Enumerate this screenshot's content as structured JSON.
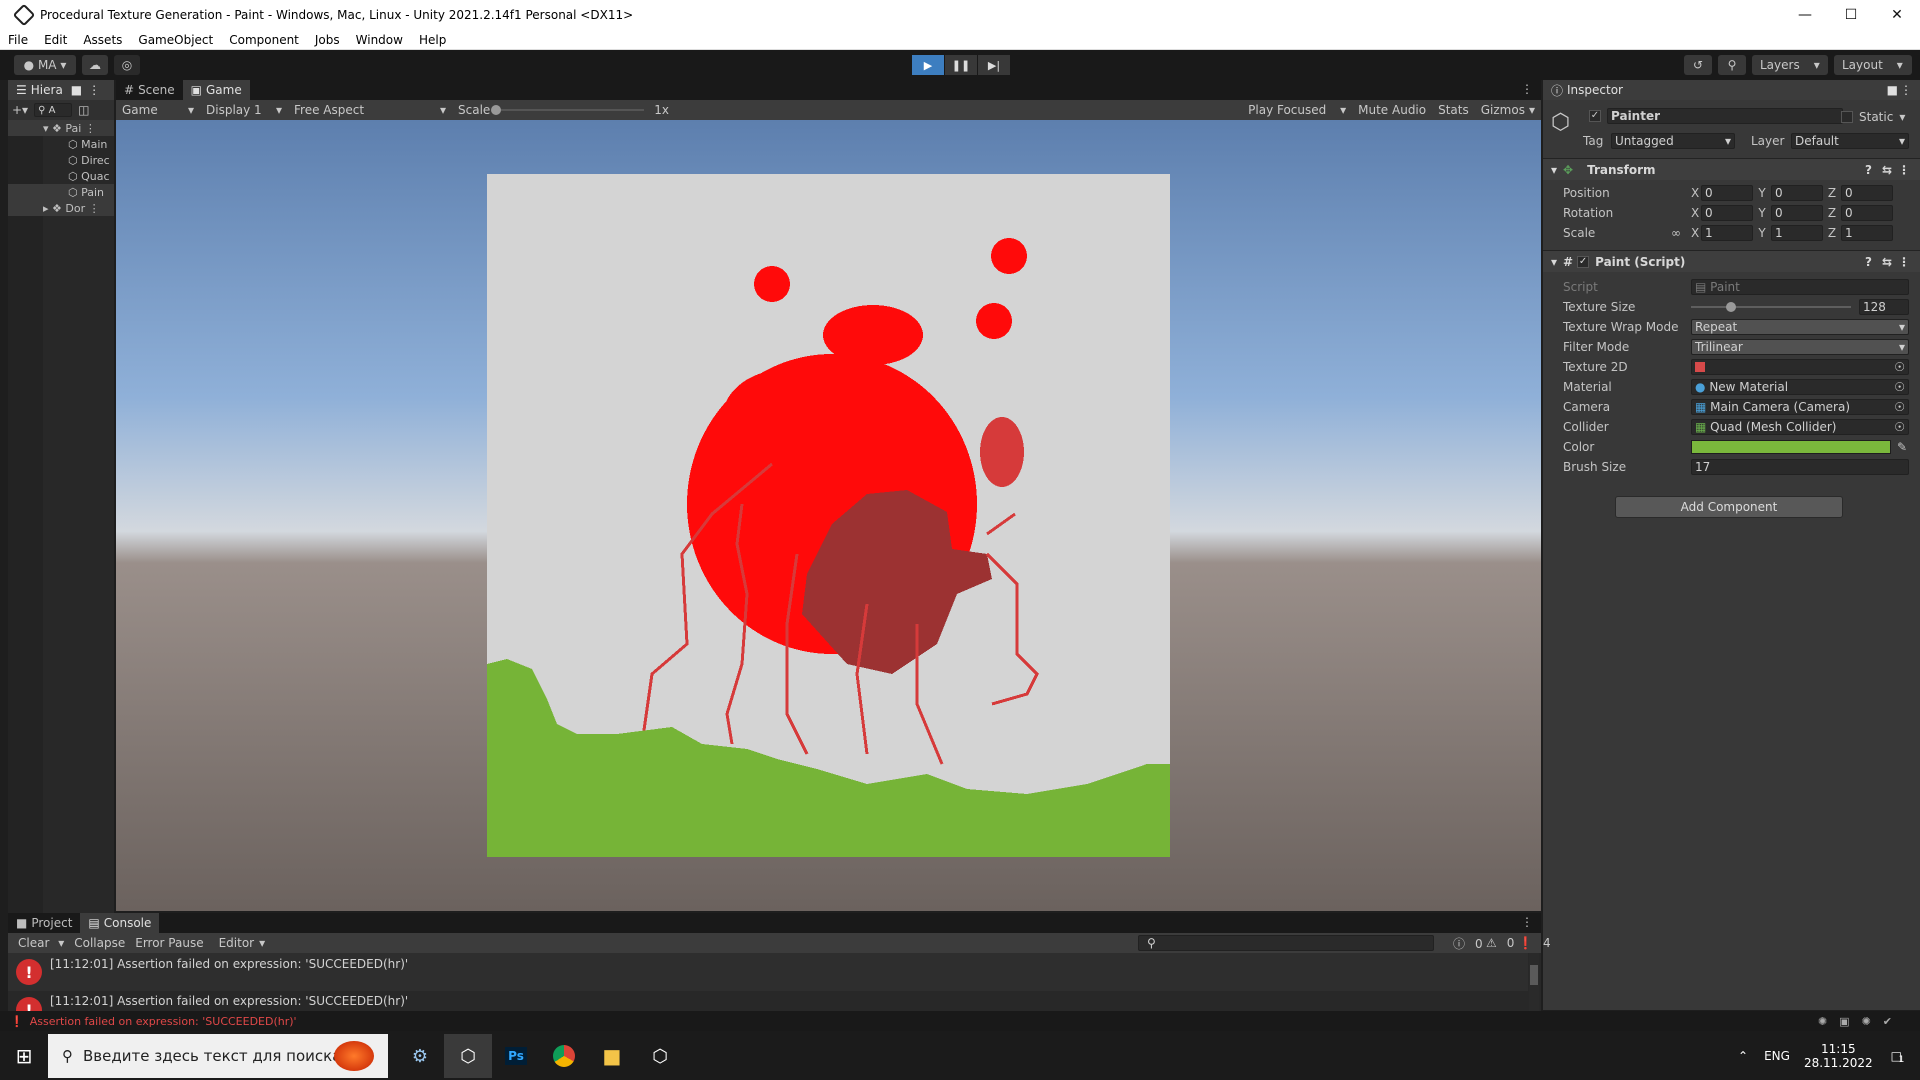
{
  "window": {
    "title": "Procedural Texture Generation - Paint - Windows, Mac, Linux - Unity 2021.2.14f1 Personal <DX11>"
  },
  "menu": [
    "File",
    "Edit",
    "Assets",
    "GameObject",
    "Component",
    "Jobs",
    "Window",
    "Help"
  ],
  "toolbar": {
    "account": "MA",
    "layers": "Layers",
    "layout": "Layout"
  },
  "hierarchy": {
    "tab": "Hiera",
    "search": "A",
    "rows": [
      "Pai",
      "Main",
      "Direc",
      "Quac",
      "Pain",
      "Dor"
    ]
  },
  "tabs": {
    "scene": "Scene",
    "game": "Game",
    "inspector": "Inspector",
    "project": "Project",
    "console": "Console"
  },
  "game_toolbar": {
    "mode": "Game",
    "display": "Display 1",
    "aspect": "Free Aspect",
    "scale_label": "Scale",
    "scale_value": "1x",
    "play_focused": "Play Focused",
    "mute": "Mute Audio",
    "stats": "Stats",
    "gizmos": "Gizmos"
  },
  "inspector": {
    "object_name": "Painter",
    "static_label": "Static",
    "tag_label": "Tag",
    "tag_value": "Untagged",
    "layer_label": "Layer",
    "layer_value": "Default",
    "transform": {
      "title": "Transform",
      "position": "Position",
      "rotation": "Rotation",
      "scale": "Scale",
      "x": "X",
      "y": "Y",
      "z": "Z",
      "pos": [
        "0",
        "0",
        "0"
      ],
      "rot": [
        "0",
        "0",
        "0"
      ],
      "scl": [
        "1",
        "1",
        "1"
      ]
    },
    "paint": {
      "title": "Paint (Script)",
      "script_label": "Script",
      "script_value": "Paint",
      "texture_size_label": "Texture Size",
      "texture_size_value": "128",
      "texture_size_fraction": 0.25,
      "wrap_label": "Texture Wrap Mode",
      "wrap_value": "Repeat",
      "filter_label": "Filter Mode",
      "filter_value": "Trilinear",
      "tex2d_label": "Texture 2D",
      "material_label": "Material",
      "material_value": "New Material",
      "camera_label": "Camera",
      "camera_value": "Main Camera (Camera)",
      "collider_label": "Collider",
      "collider_value": "Quad (Mesh Collider)",
      "color_label": "Color",
      "color_value": "#7ab83c",
      "brush_label": "Brush Size",
      "brush_value": "17"
    },
    "add_component": "Add Component"
  },
  "console": {
    "clear": "Clear",
    "collapse": "Collapse",
    "error_pause": "Error Pause",
    "editor": "Editor",
    "count_info": "0",
    "count_warn": "0",
    "count_err": "4",
    "lines": [
      "[11:12:01] Assertion failed on expression: 'SUCCEEDED(hr)'",
      "[11:12:01] Assertion failed on expression: 'SUCCEEDED(hr)'"
    ]
  },
  "status": {
    "message": "Assertion failed on expression: 'SUCCEEDED(hr)'"
  },
  "taskbar": {
    "search_placeholder": "Введите здесь текст для поиска",
    "lang": "ENG",
    "time": "11:15",
    "date": "28.11.2022",
    "notif": "1"
  },
  "colors": {
    "paint_red": "#ff0a0a",
    "paint_dark": "#9c3232",
    "grass": "#76b437",
    "canvas_bg": "#d4d4d4",
    "accent": "#3d7ec0"
  }
}
